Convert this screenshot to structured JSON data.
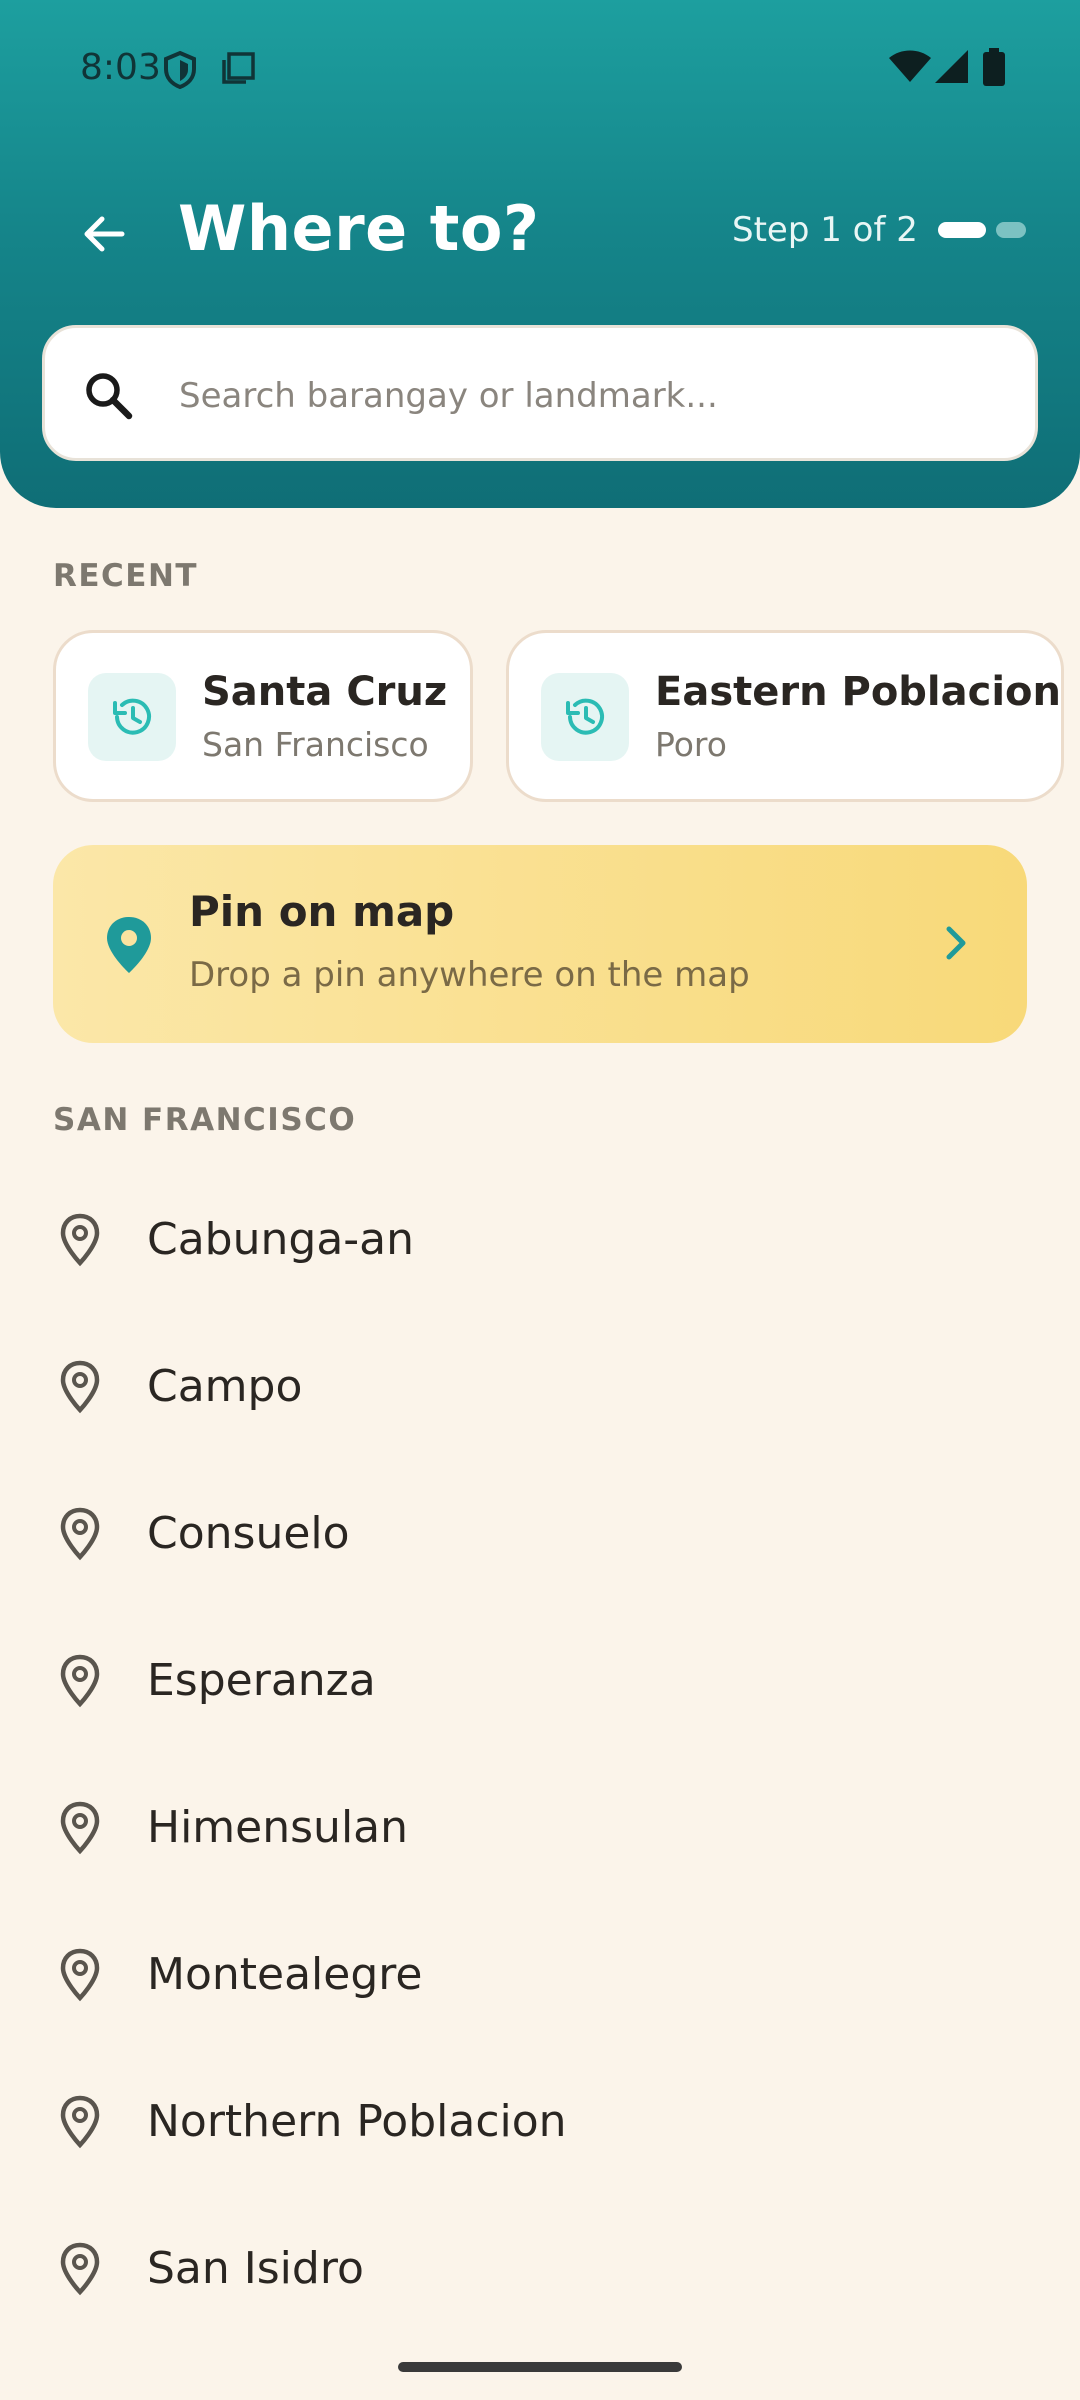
{
  "status_bar": {
    "time": "8:03",
    "icons": [
      "shield-icon",
      "sim-card-icon",
      "wifi-icon",
      "cell-signal-icon",
      "battery-icon"
    ]
  },
  "header": {
    "title": "Where to?",
    "step_label": "Step 1 of 2",
    "step_current": 1,
    "step_total": 2,
    "colors": {
      "gradient_top": "#1d9f9f",
      "gradient_bottom": "#0f6e76"
    }
  },
  "search": {
    "placeholder": "Search barangay or landmark...",
    "value": ""
  },
  "recent": {
    "label": "RECENT",
    "items": [
      {
        "title": "Santa Cruz",
        "subtitle": "San Francisco",
        "icon": "history-icon"
      },
      {
        "title": "Eastern Poblacion",
        "subtitle": "Poro",
        "icon": "history-icon"
      }
    ]
  },
  "pin_on_map": {
    "title": "Pin on map",
    "subtitle": "Drop a pin anywhere on the map",
    "icon": "location-pin-icon",
    "accent": "#1f9a9a"
  },
  "city_section": {
    "label": "SAN FRANCISCO",
    "items": [
      {
        "label": "Cabunga-an"
      },
      {
        "label": "Campo"
      },
      {
        "label": "Consuelo"
      },
      {
        "label": "Esperanza"
      },
      {
        "label": "Himensulan"
      },
      {
        "label": "Montealegre"
      },
      {
        "label": "Northern Poblacion"
      },
      {
        "label": "San Isidro"
      }
    ]
  }
}
